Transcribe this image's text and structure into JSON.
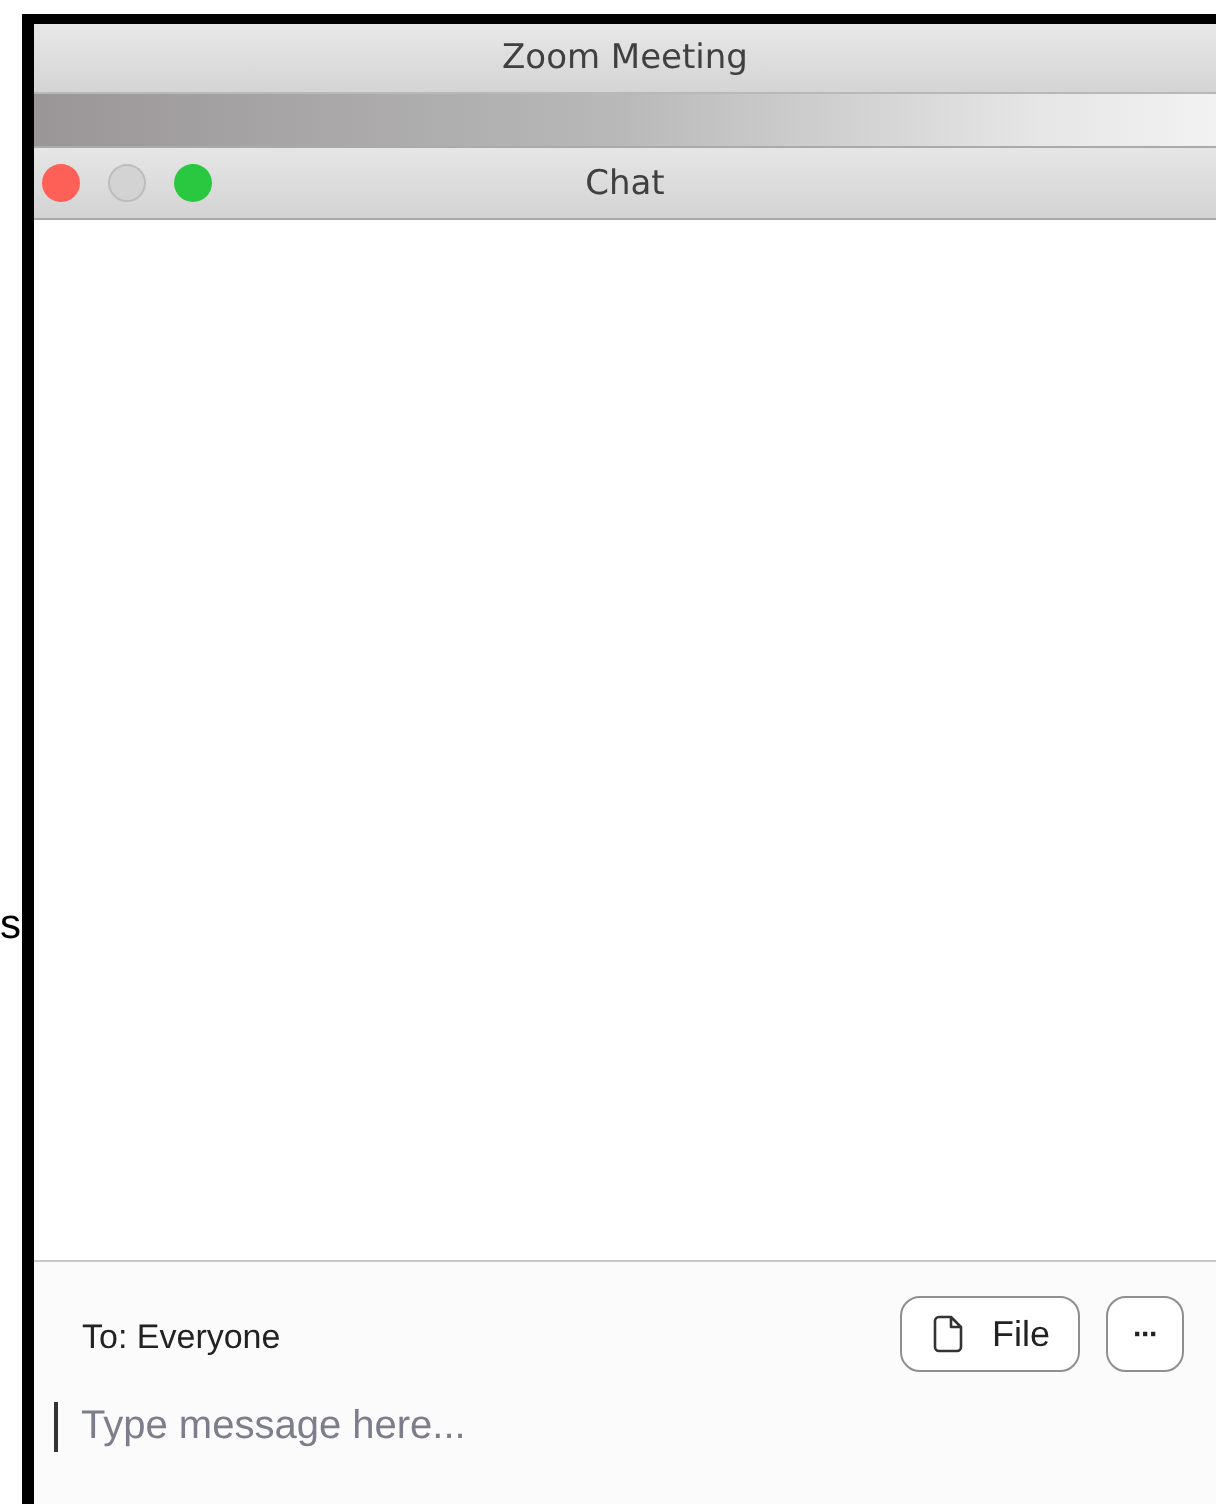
{
  "side_text": "s",
  "window": {
    "title": "Zoom Meeting"
  },
  "chat_window": {
    "title": "Chat",
    "window_controls": [
      {
        "kind": "close",
        "color": "#fe5f57"
      },
      {
        "kind": "minimize",
        "color": "#d3d3d3"
      },
      {
        "kind": "zoom",
        "color": "#2ac840"
      }
    ]
  },
  "footer": {
    "recipient": "To: Everyone",
    "file_button": "File",
    "more_button": "···",
    "message_input": {
      "placeholder": "Type message here..."
    }
  }
}
